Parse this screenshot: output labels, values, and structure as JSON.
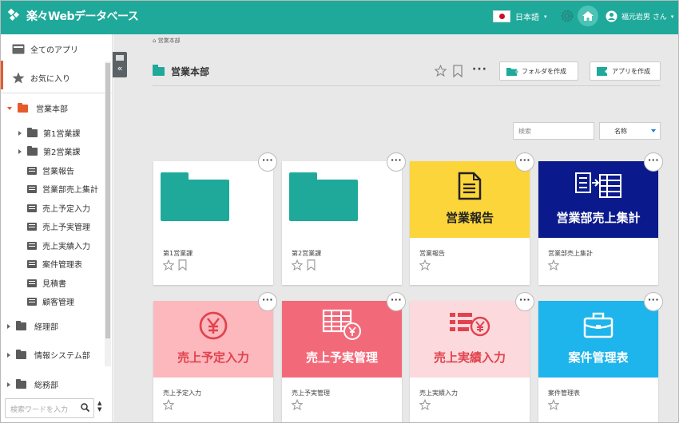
{
  "header": {
    "logo_text": "楽々Webデータベース",
    "language": "日本語",
    "user_name": "福元岩男 さん"
  },
  "sidebar": {
    "all_apps": "全てのアプリ",
    "favorites": "お気に入り",
    "selected_folder": "営業本部",
    "children": [
      {
        "label": "第1営業課",
        "type": "folder"
      },
      {
        "label": "第2営業課",
        "type": "folder"
      },
      {
        "label": "営業報告",
        "type": "app"
      },
      {
        "label": "営業部売上集計",
        "type": "app"
      },
      {
        "label": "売上予定入力",
        "type": "app"
      },
      {
        "label": "売上予実管理",
        "type": "app"
      },
      {
        "label": "売上実績入力",
        "type": "app"
      },
      {
        "label": "案件管理表",
        "type": "app"
      },
      {
        "label": "見積書",
        "type": "app"
      },
      {
        "label": "顧客管理",
        "type": "app"
      }
    ],
    "other_folders": [
      "経理部",
      "情報システム部",
      "総務部"
    ],
    "search_placeholder": "検索ワードを入力"
  },
  "main": {
    "breadcrumb": "営業本部",
    "title": "営業本部",
    "create_folder_label": "フォルダを作成",
    "create_app_label": "アプリを作成",
    "search_placeholder": "検索",
    "sort_value": "名称",
    "cards": [
      {
        "label": "第1営業課",
        "type": "folder",
        "bg": "#ffffff"
      },
      {
        "label": "第2営業課",
        "type": "folder",
        "bg": "#ffffff"
      },
      {
        "label": "営業報告",
        "type": "app",
        "title": "営業報告",
        "bg": "#fcd53a",
        "fg": "#222222",
        "icon": "document-icon"
      },
      {
        "label": "営業部売上集計",
        "type": "app",
        "title": "営業部売上集計",
        "bg": "#0a1a8c",
        "fg": "#ffffff",
        "icon": "table-merge-icon"
      },
      {
        "label": "売上予定入力",
        "type": "app",
        "title": "売上予定入力",
        "bg": "#fcb8bc",
        "fg": "#e0434f",
        "icon": "yen-circle-icon"
      },
      {
        "label": "売上予実管理",
        "type": "app",
        "title": "売上予実管理",
        "bg": "#f26a79",
        "fg": "#ffffff",
        "icon": "table-yen-icon"
      },
      {
        "label": "売上実績入力",
        "type": "app",
        "title": "売上実績入力",
        "bg": "#fcd9dc",
        "fg": "#e0434f",
        "icon": "list-yen-icon"
      },
      {
        "label": "案件管理表",
        "type": "app",
        "title": "案件管理表",
        "bg": "#1eb4ec",
        "fg": "#ffffff",
        "icon": "briefcase-icon"
      }
    ]
  },
  "colors": {
    "accent": "#1fa99b",
    "selected": "#e55b2a"
  }
}
